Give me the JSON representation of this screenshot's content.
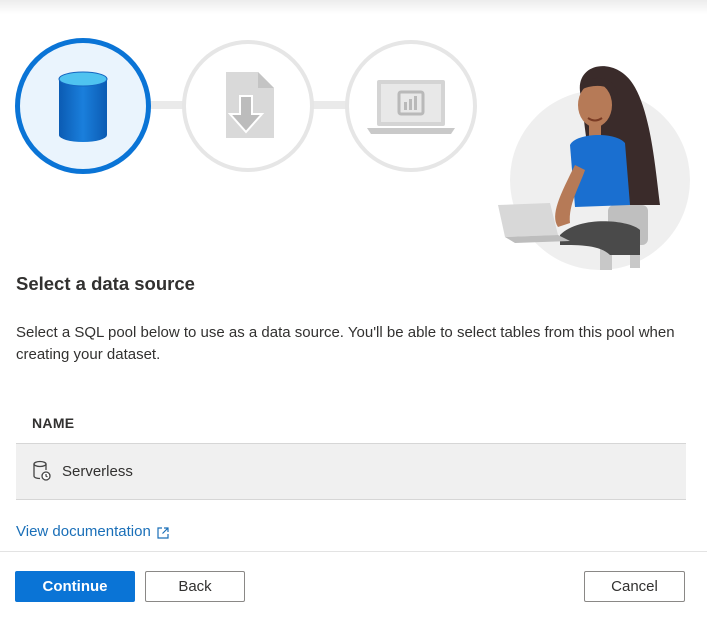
{
  "wizard": {
    "steps": [
      {
        "name": "data-source",
        "icon": "database-icon",
        "active": true
      },
      {
        "name": "download",
        "icon": "download-file-icon",
        "active": false
      },
      {
        "name": "report",
        "icon": "laptop-report-icon",
        "active": false
      }
    ]
  },
  "title": "Select a data source",
  "description": "Select a SQL pool below to use as a data source. You'll be able to select tables from this pool when creating your dataset.",
  "table": {
    "column_name": "NAME",
    "rows": [
      {
        "label": "Serverless",
        "icon": "sql-pool-icon"
      }
    ]
  },
  "links": {
    "view_documentation": "View documentation"
  },
  "buttons": {
    "continue": "Continue",
    "back": "Back",
    "cancel": "Cancel"
  },
  "colors": {
    "accent": "#0a74d6",
    "link": "#1a6fb8",
    "row_bg": "#f0f0f0"
  }
}
